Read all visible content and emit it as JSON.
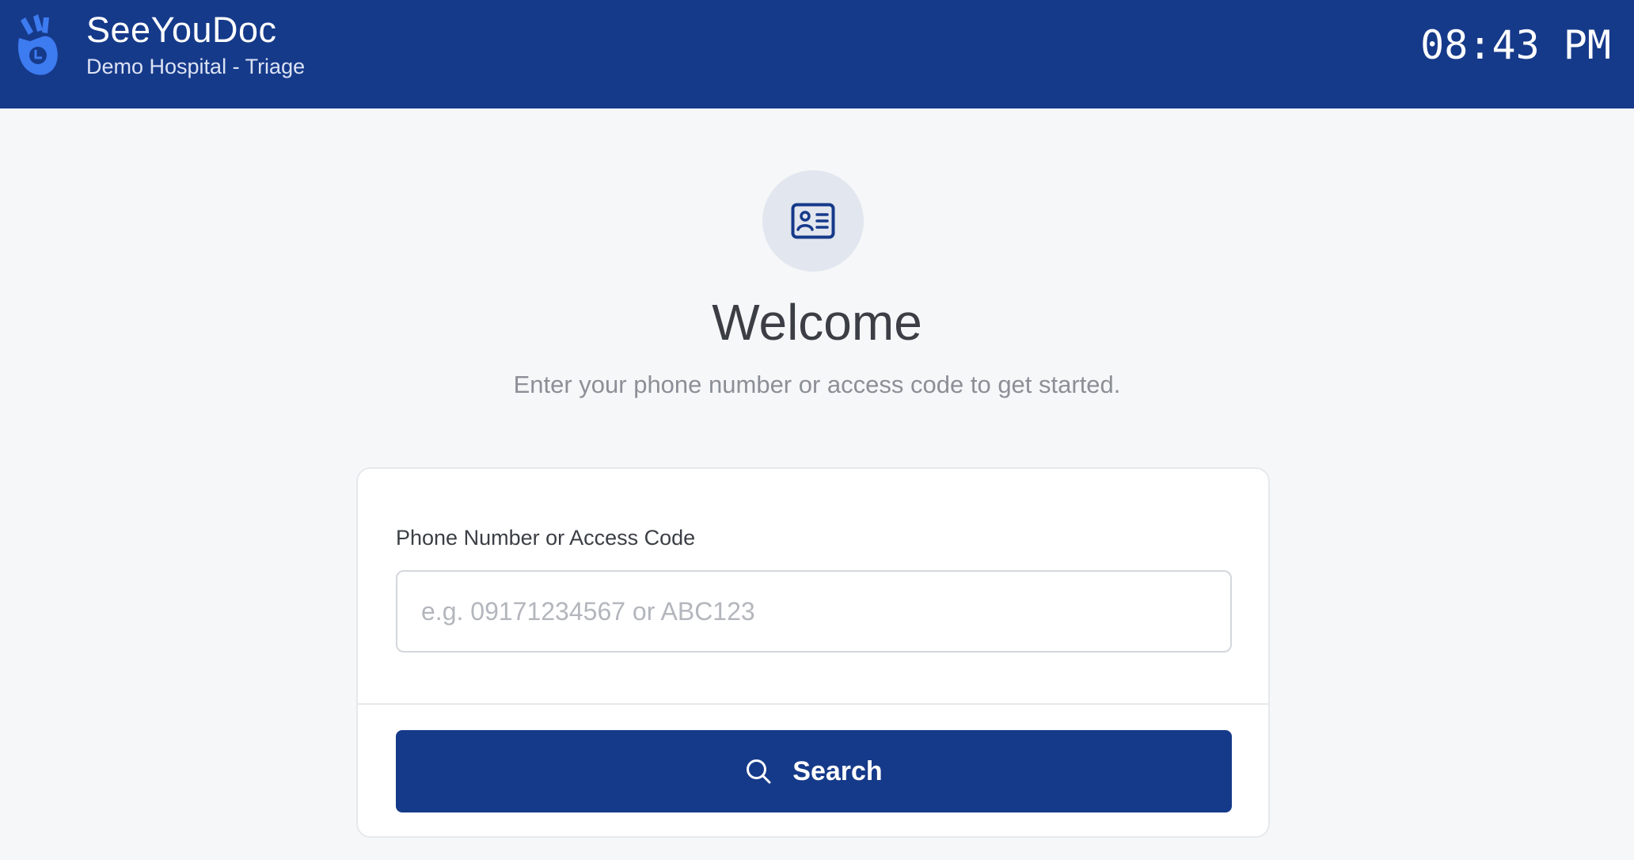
{
  "header": {
    "app_name": "SeeYouDoc",
    "subtitle": "Demo Hospital - Triage",
    "clock": "08:43 PM",
    "logo_icon": "hand-gesture-logo-icon"
  },
  "main": {
    "icon": "id-card-icon",
    "title": "Welcome",
    "subtitle": "Enter your phone number or access code to get started."
  },
  "form": {
    "field_label": "Phone Number or Access Code",
    "field_value": "",
    "field_placeholder": "e.g. 09171234567 or ABC123",
    "button_label": "Search",
    "button_icon": "search-icon"
  },
  "colors": {
    "primary": "#163a8a",
    "logo_accent": "#3d7bf0",
    "background": "#f6f7f9",
    "card": "#ffffff",
    "icon_circle": "#e2e6ee"
  }
}
